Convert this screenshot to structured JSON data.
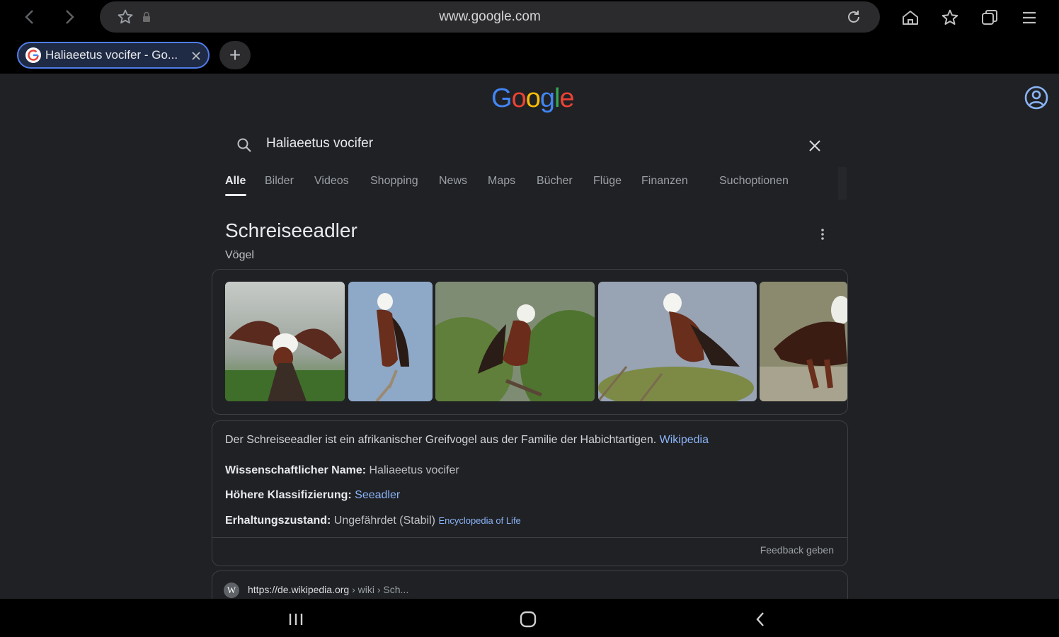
{
  "browser": {
    "url": "www.google.com",
    "tab_title": "Haliaeetus vocifer - Go...",
    "new_tab_symbol": "+"
  },
  "google": {
    "logo_letters": [
      "G",
      "o",
      "o",
      "g",
      "l",
      "e"
    ],
    "logo_colors": [
      "#4285f4",
      "#ea4335",
      "#fbbc05",
      "#4285f4",
      "#34a853",
      "#ea4335"
    ],
    "search_value": "Haliaeetus vocifer",
    "tabs": [
      "Alle",
      "Bilder",
      "Videos",
      "Shopping",
      "News",
      "Maps",
      "Bücher",
      "Flüge",
      "Finanzen",
      "Suchoptionen"
    ]
  },
  "knowledge_panel": {
    "title": "Schreiseeadler",
    "subtitle": "Vögel",
    "images": [
      "fish-eagle-wings-spread",
      "fish-eagle-on-branch",
      "fish-eagle-in-tree",
      "fish-eagle-perched",
      "fish-eagle-standing"
    ],
    "description": "Der Schreiseeadler ist ein afrikanischer Greifvogel aus der Familie der Habichtartigen.",
    "description_link": "Wikipedia",
    "facts": [
      {
        "label": "Wissenschaftlicher Name:",
        "value": "Haliaeetus vocifer",
        "link": ""
      },
      {
        "label": "Höhere Klassifizierung:",
        "value": "",
        "link": "Seeadler"
      },
      {
        "label": "Erhaltungszustand:",
        "value": "Ungefährdet (Stabil)",
        "link": "Encyclopedia of Life"
      }
    ],
    "feedback": "Feedback geben"
  },
  "result": {
    "url": "https://de.wikipedia.org",
    "path": " › wiki › Sch..."
  },
  "colors": {
    "accent": "#8ab4f8",
    "background": "#202124",
    "tab_border": "#4f7de8"
  }
}
